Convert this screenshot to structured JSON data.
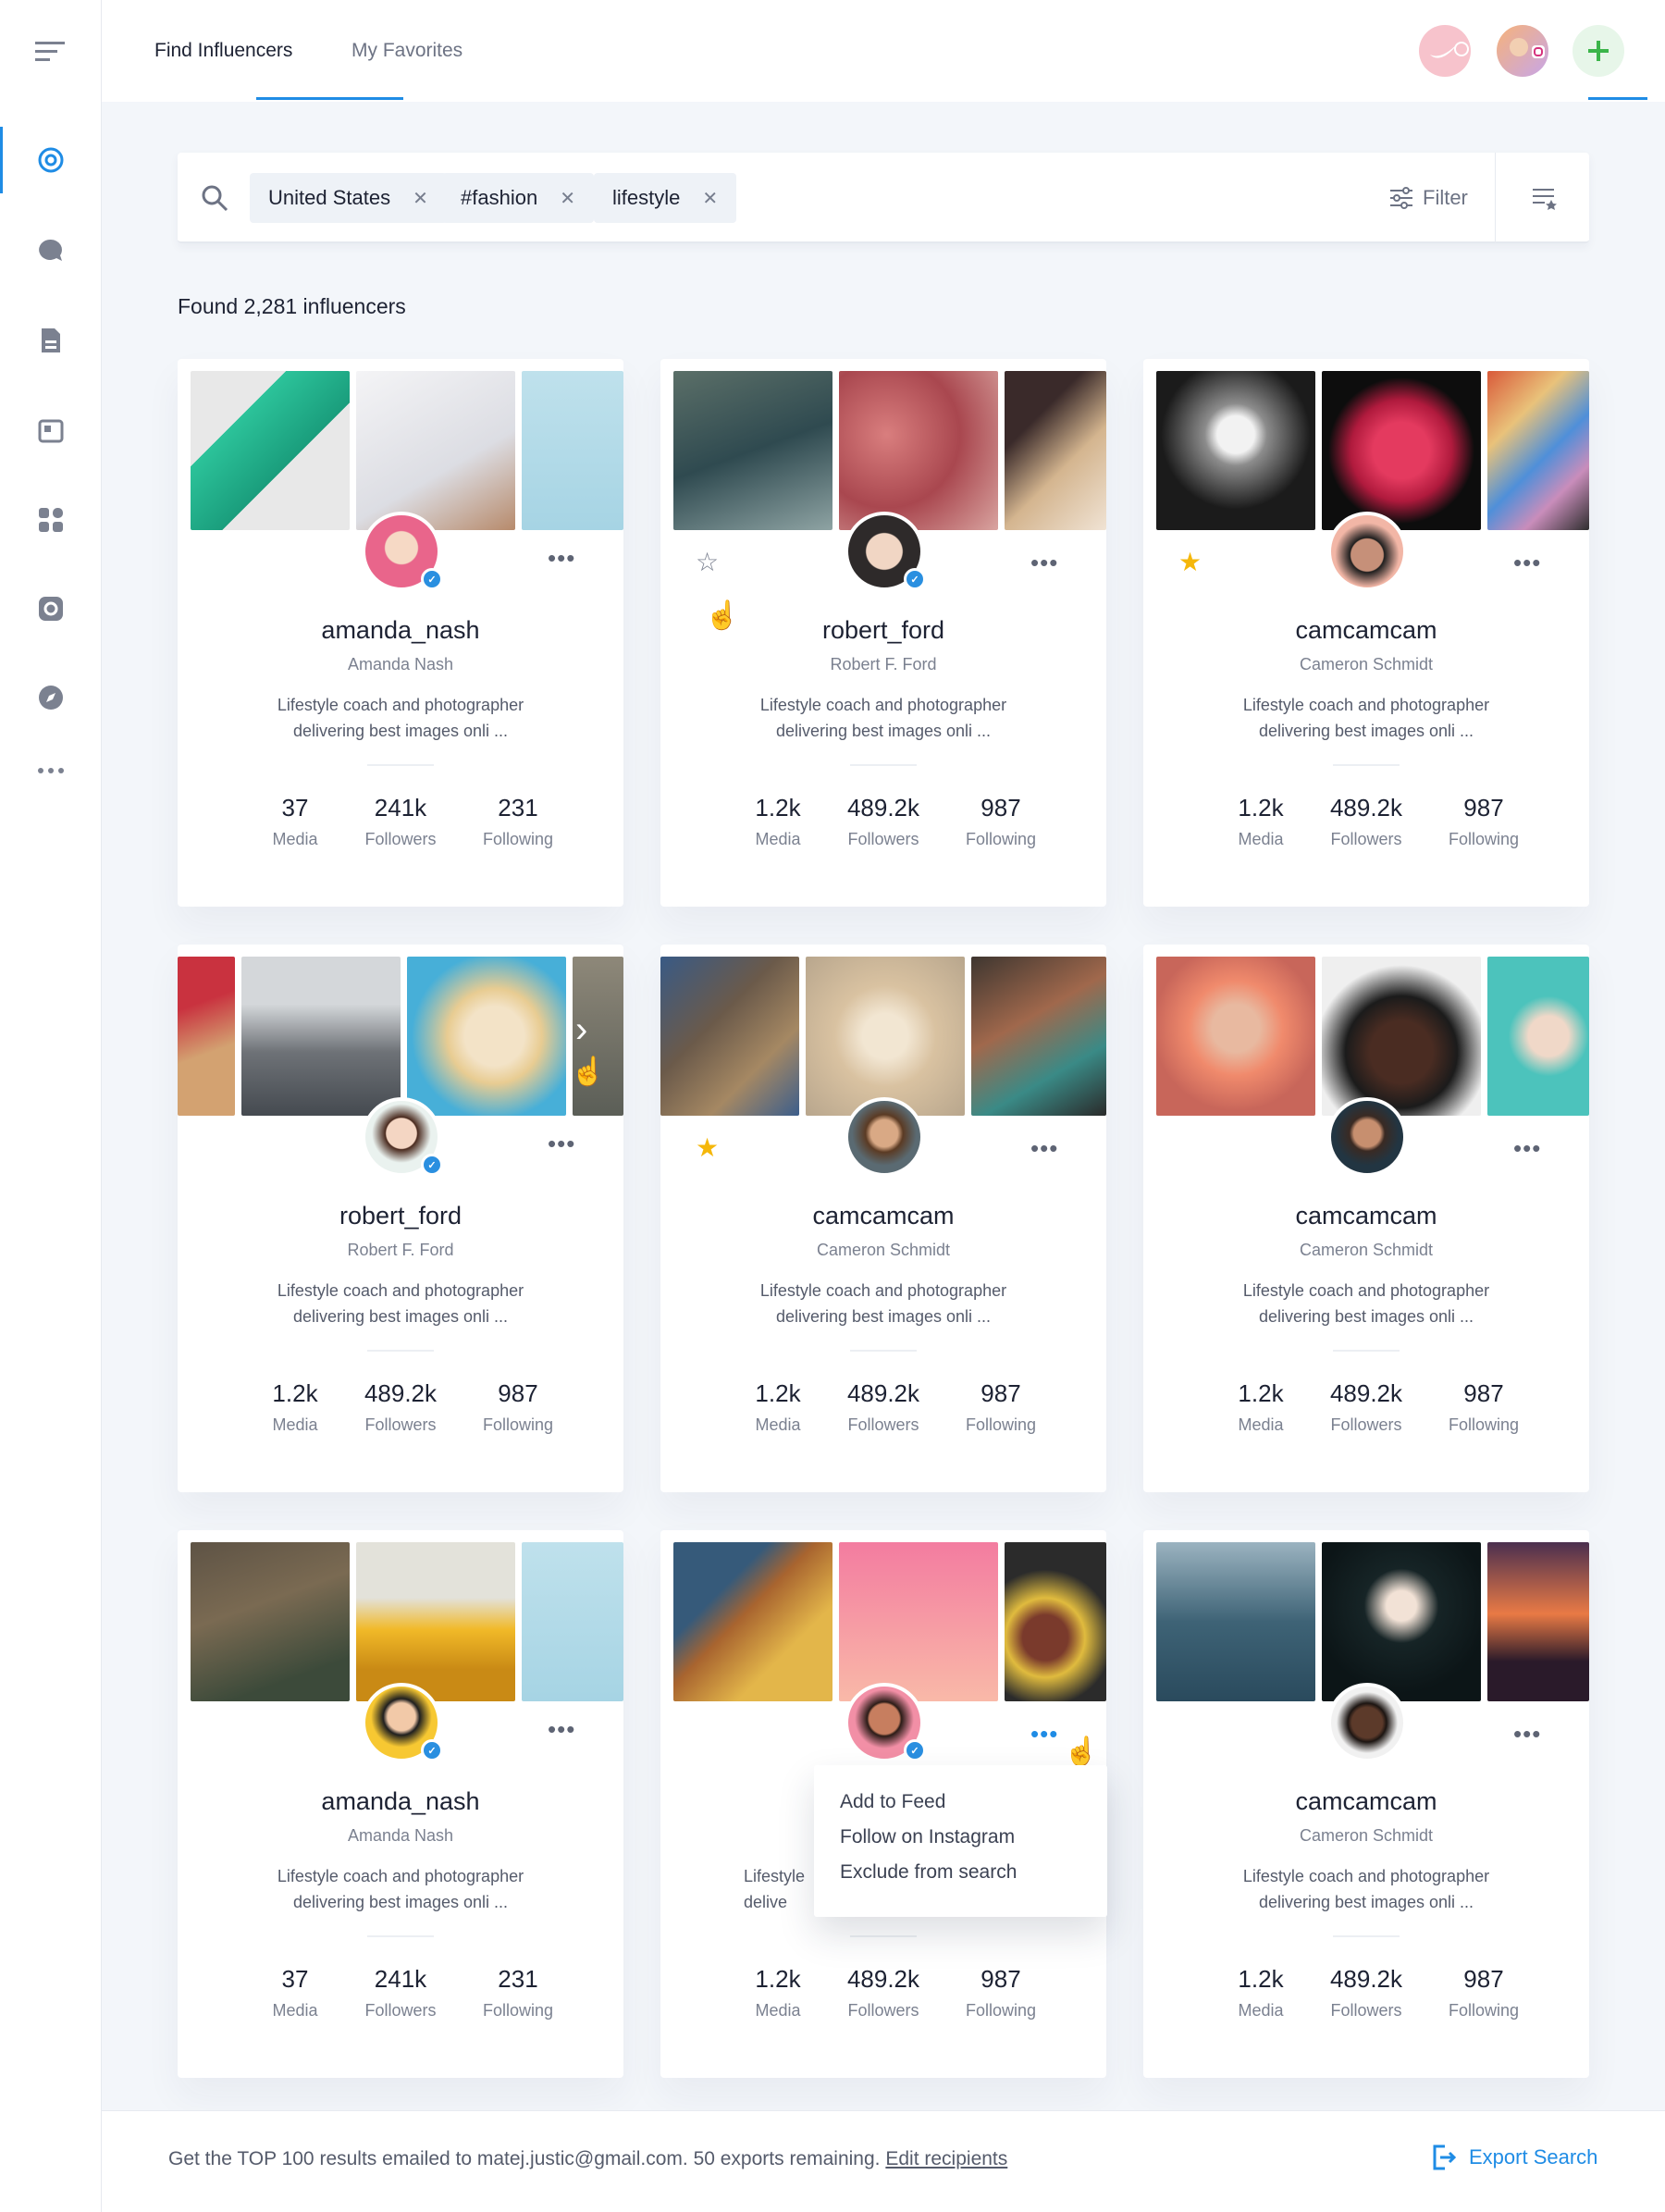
{
  "nav": {
    "tabs": [
      {
        "label": "Find Influencers"
      },
      {
        "label": "My Favorites"
      }
    ]
  },
  "search": {
    "chips": [
      "United States",
      "#fashion",
      "lifestyle"
    ],
    "filter_label": "Filter"
  },
  "results_count": "Found 2,281 influencers",
  "colors": {
    "accent": "#1f8ce5",
    "star": "#f5b70a",
    "add": "#3bb54a"
  },
  "cards": [
    {
      "username": "amanda_nash",
      "name": "Amanda Nash",
      "bio1": "Lifestyle coach and photographer",
      "bio2": "delivering best images onli ...",
      "media": "37",
      "followers": "241k",
      "following": "231",
      "starred": "none"
    },
    {
      "username": "robert_ford",
      "name": "Robert F. Ford",
      "bio1": "Lifestyle coach and photographer",
      "bio2": "delivering best images onli ...",
      "media": "1.2k",
      "followers": "489.2k",
      "following": "987",
      "starred": "outline"
    },
    {
      "username": "camcamcam",
      "name": "Cameron Schmidt",
      "bio1": "Lifestyle coach and photographer",
      "bio2": "delivering best images onli ...",
      "media": "1.2k",
      "followers": "489.2k",
      "following": "987",
      "starred": "filled"
    },
    {
      "username": "robert_ford",
      "name": "Robert F. Ford",
      "bio1": "Lifestyle coach and photographer",
      "bio2": "delivering best images onli ...",
      "media": "1.2k",
      "followers": "489.2k",
      "following": "987",
      "starred": "none"
    },
    {
      "username": "camcamcam",
      "name": "Cameron Schmidt",
      "bio1": "Lifestyle coach and photographer",
      "bio2": "delivering best images onli ...",
      "media": "1.2k",
      "followers": "489.2k",
      "following": "987",
      "starred": "filled"
    },
    {
      "username": "camcamcam",
      "name": "Cameron Schmidt",
      "bio1": "Lifestyle coach and photographer",
      "bio2": "delivering best images onli ...",
      "media": "1.2k",
      "followers": "489.2k",
      "following": "987",
      "starred": "none"
    },
    {
      "username": "amanda_nash",
      "name": "Amanda Nash",
      "bio1": "Lifestyle coach and photographer",
      "bio2": "delivering best images onli ...",
      "media": "37",
      "followers": "241k",
      "following": "231",
      "starred": "none"
    },
    {
      "username": "",
      "name": "",
      "bio1": "Lifestyle",
      "bio2": "delive",
      "media": "1.2k",
      "followers": "489.2k",
      "following": "987",
      "starred": "none"
    },
    {
      "username": "camcamcam",
      "name": "Cameron Schmidt",
      "bio1": "Lifestyle coach and photographer",
      "bio2": "delivering best images onli ...",
      "media": "1.2k",
      "followers": "489.2k",
      "following": "987",
      "starred": "none"
    }
  ],
  "stat_labels": {
    "media": "Media",
    "followers": "Followers",
    "following": "Following"
  },
  "dropdown": {
    "items": [
      "Add to Feed",
      "Follow on Instagram",
      "Exclude from search"
    ]
  },
  "footer": {
    "text": "Get the TOP 100 results emailed to matej.justic@gmail.com. 50 exports remaining.",
    "link": "Edit recipients",
    "export_label": "Export Search"
  },
  "icons": {
    "menu": "menu-icon",
    "search": "search-icon",
    "filter": "filter-icon",
    "sort": "sort-icon",
    "export": "export-icon"
  }
}
